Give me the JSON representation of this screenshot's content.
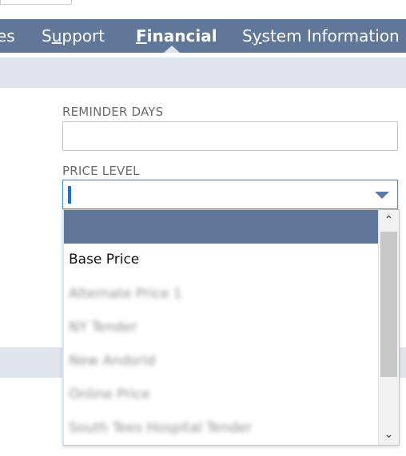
{
  "tabs": [
    {
      "label": "es"
    },
    {
      "label": "Support"
    },
    {
      "label": "Financial"
    },
    {
      "label": "System Information"
    }
  ],
  "active_tab": "Financial",
  "fields": {
    "reminder_days": {
      "label": "REMINDER DAYS",
      "value": ""
    },
    "price_level": {
      "label": "PRICE LEVEL",
      "value": ""
    }
  },
  "dropdown": {
    "options": [
      {
        "label": ""
      },
      {
        "label": "Base Price"
      },
      {
        "label": "Alternate Price 1"
      },
      {
        "label": "NY Tender"
      },
      {
        "label": "New Andorid"
      },
      {
        "label": "Online Price"
      },
      {
        "label": "South Tees Hospital Tender"
      }
    ],
    "scroll_up_glyph": "⌃",
    "scroll_down_glyph": "⌄"
  },
  "colors": {
    "tabbar": "#607799",
    "band": "#e0e5ed",
    "focus": "#4a90d9"
  }
}
